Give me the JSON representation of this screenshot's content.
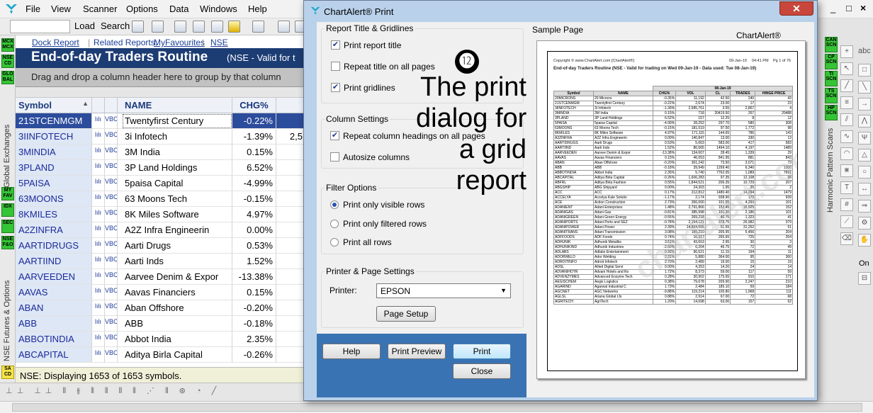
{
  "menu": {
    "items": [
      "File",
      "View",
      "Scanner",
      "Options",
      "Data",
      "Windows",
      "Help"
    ],
    "window_controls": [
      "_",
      "□",
      "×"
    ]
  },
  "toolbar": {
    "load_label": "Load",
    "search_label": "Search"
  },
  "left_strip": {
    "badges": [
      "MCX MCX",
      "NSE CD",
      "GLO BAL",
      "MY FAV",
      "IDX",
      "SEC",
      "NSE F&O",
      "SA CD"
    ],
    "labels": [
      "Global Exchanges",
      "NSE Futures & Options"
    ]
  },
  "report": {
    "dock_report": "Dock Report",
    "related_reports_label": "Related Reports:",
    "my_favourites": "MyFavourites",
    "nse": "NSE",
    "title": "End-of-day Traders Routine",
    "subtitle": "(NSE - Valid for t",
    "group_hint": "Drag and drop a column header here to group by that column"
  },
  "grid": {
    "columns": {
      "symbol": "Symbol",
      "name": "NAME",
      "chg": "CHG%"
    },
    "rows": [
      {
        "symbol": "21STCENMGM",
        "name": "Twentyfirst Century",
        "chg": "-0.22%",
        "vol": "",
        "selected": true
      },
      {
        "symbol": "3IINFOTECH",
        "name": "3i Infotech",
        "chg": "-1.39%",
        "vol": "2,5"
      },
      {
        "symbol": "3MINDIA",
        "name": "3M India",
        "chg": "0.15%",
        "vol": ""
      },
      {
        "symbol": "3PLAND",
        "name": "3P Land Holdings",
        "chg": "6.52%",
        "vol": ""
      },
      {
        "symbol": "5PAISA",
        "name": "5paisa Capital",
        "chg": "-4.99%",
        "vol": ""
      },
      {
        "symbol": "63MOONS",
        "name": "63 Moons Tech",
        "chg": "-0.15%",
        "vol": ""
      },
      {
        "symbol": "8KMILES",
        "name": "8K Miles Software",
        "chg": "4.97%",
        "vol": ""
      },
      {
        "symbol": "A2ZINFRA",
        "name": "A2Z Infra Engineerin",
        "chg": "0.00%",
        "vol": ""
      },
      {
        "symbol": "AARTIDRUGS",
        "name": "Aarti Drugs",
        "chg": "0.53%",
        "vol": ""
      },
      {
        "symbol": "AARTIIND",
        "name": "Aarti Inds",
        "chg": "1.52%",
        "vol": ""
      },
      {
        "symbol": "AARVEEDEN",
        "name": "Aarvee Denim & Expor",
        "chg": "-13.38%",
        "vol": ""
      },
      {
        "symbol": "AAVAS",
        "name": "Aavas Financiers",
        "chg": "0.15%",
        "vol": ""
      },
      {
        "symbol": "ABAN",
        "name": "Aban Offshore",
        "chg": "-0.20%",
        "vol": ""
      },
      {
        "symbol": "ABB",
        "name": "ABB",
        "chg": "-0.18%",
        "vol": ""
      },
      {
        "symbol": "ABBOTINDIA",
        "name": "Abbot India",
        "chg": "2.35%",
        "vol": ""
      },
      {
        "symbol": "ABCAPITAL",
        "name": "Aditya Birla Capital",
        "chg": "-0.26%",
        "vol": ""
      }
    ],
    "icon1": "lılı",
    "icon2": "VBC",
    "status": "NSE: Displaying 1653 of 1653 symbols."
  },
  "right_panel": {
    "badges": [
      "CAN SCN",
      "CP SCN",
      "TI SCN",
      "TS SCN",
      "HP SCN"
    ],
    "vertical_label": "Harmonic Pattern Scans",
    "on_label": "On",
    "tools_top": "abc"
  },
  "dialog": {
    "title": "ChartAlert® Print",
    "close": "✕",
    "report_title_group": "Report Title & Gridlines",
    "print_report_title": "Print report title",
    "repeat_title": "Repeat title on all pages",
    "print_gridlines": "Print gridlines",
    "column_settings_group": "Column Settings",
    "repeat_headings": "Repeat column headings on all pages",
    "autosize_columns": "Autosize columns",
    "filter_group": "Filter Options",
    "print_visible": "Print only visible rows",
    "print_filtered": "Print only filtered rows",
    "print_all": "Print all rows",
    "printer_group": "Printer & Page Settings",
    "printer_label": "Printer:",
    "printer_value": "EPSON",
    "page_setup": "Page Setup",
    "help": "Help",
    "print_preview": "Print Preview",
    "print": "Print",
    "close_btn": "Close",
    "sample_page": "Sample Page",
    "brand": "ChartAlert®",
    "checks": {
      "print_report_title": true,
      "repeat_title": false,
      "print_gridlines": true,
      "repeat_headings": true,
      "autosize_columns": false
    },
    "filter_selected": "visible"
  },
  "preview": {
    "copyright": "Copyright © www.ChartAlert.com [ChartAlert®]",
    "date": "09-Jan-19",
    "time": "04:41 PM",
    "page": "Pg 1 of 76",
    "title": "End-of-day Traders Routine (NSE - Valid for trading on Wed 09-Jan-19 - Data used: Tue 08-Jan-19)",
    "table_date": "08-Jan-19",
    "headers": [
      "Symbol",
      "NAME",
      "CHG%",
      "VOL",
      "CL",
      "TRADES",
      "HINGE PRICE"
    ],
    "watermark": "chartalert.com",
    "rows": [
      [
        "20MICRONS",
        "20 Microns",
        "-0.35%",
        "11,192",
        "42.50",
        "240",
        "43"
      ],
      [
        "21STCENMGM",
        "Twentyfirst Century",
        "-0.22%",
        "2,674",
        "23.00",
        "17",
        "23"
      ],
      [
        "3IINFOTECH",
        "3i Infotech",
        "-1.39%",
        "2,585,761",
        "3.55",
        "2,867",
        "4"
      ],
      [
        "3MINDIA",
        "3M India",
        "0.15%",
        "718",
        "20419.50",
        "267",
        "20488"
      ],
      [
        "3PLAND",
        "3P Land Holdings",
        "6.52%",
        "157",
        "12.25",
        "8",
        "12"
      ],
      [
        "5PAISA",
        "5paisa Capital",
        "-4.99%",
        "28,252",
        "297.70",
        "580",
        "308"
      ],
      [
        "63MOONS",
        "63 Moons Tech",
        "-0.15%",
        "181,519",
        "97.50",
        "1,772",
        "98"
      ],
      [
        "8KMILES",
        "8K Miles Software",
        "4.97%",
        "171,115",
        "144.65",
        "786",
        "143"
      ],
      [
        "A2ZINFRA",
        "A2Z Infra Engineerin",
        "0.00%",
        "140,847",
        "13.00",
        "330",
        "13"
      ],
      [
        "AARTIDRUGS",
        "Aarti Drugs",
        "0.53%",
        "5,663",
        "583.00",
        "417",
        "583"
      ],
      [
        "AARTIIND",
        "Aarti Inds",
        "1.52%",
        "86,665",
        "1494.10",
        "4,197",
        "1489"
      ],
      [
        "AARVEEDEN",
        "Aarvee Denim & Expor",
        "-13.38%",
        "134,607",
        "28.45",
        "1,339",
        "29"
      ],
      [
        "AAVAS",
        "Aavas Financiers",
        "0.15%",
        "46,053",
        "841.95",
        "881",
        "843"
      ],
      [
        "ABAN",
        "Aban Offshore",
        "-0.20%",
        "301,242",
        "73.50",
        "3,071",
        "73"
      ],
      [
        "ABB",
        "ABB",
        "-0.18%",
        "39,949",
        "1299.40",
        "6,340",
        "1300"
      ],
      [
        "ABBOTINDIA",
        "Abbot India",
        "2.35%",
        "5,740",
        "7762.05",
        "1,089",
        "7691"
      ],
      [
        "ABCAPITAL",
        "Aditya Birla Capital",
        "-0.26%",
        "1,606,283",
        "97.35",
        "12,108",
        "98"
      ],
      [
        "ABFRL",
        "Aditya Birla Fashion",
        "0.55%",
        "1,844,521",
        "206.35",
        "10,729",
        "207"
      ],
      [
        "ABGSHIP",
        "ABG Shipyard",
        "0.00%",
        "24,303",
        "1.95",
        "35",
        "2"
      ],
      [
        "ACC",
        "ACC",
        "0.17%",
        "212,812",
        "1480.40",
        "14,294",
        "1479"
      ],
      [
        "ACCELYA",
        "Accelya Kale Solutio",
        "-1.17%",
        "2,174",
        "938.90",
        "170",
        "939"
      ],
      [
        "ACE",
        "Action Construction",
        "2.73%",
        "356,000",
        "101.55",
        "4,293",
        "101"
      ],
      [
        "ADANIENT",
        "Adani Enterprises",
        "1.48%",
        "2,791,866",
        "153.45",
        "16,925",
        "152"
      ],
      [
        "ADANIGAS",
        "Adani Gas",
        "-0.81%",
        "385,998",
        "101.30",
        "2,186",
        "101"
      ],
      [
        "ADANIGREEN",
        "Adani Green Energy",
        "-0.55%",
        "269,218",
        "40.75",
        "1,323",
        "41"
      ],
      [
        "ADANIPORTS",
        "Adani Ports and SEZ",
        "-0.78%",
        "2,154,121",
        "378.75",
        "26,982",
        "379"
      ],
      [
        "ADANIPOWER",
        "Adani Power",
        "2.39%",
        "14,864,555",
        "51.55",
        "31,252",
        "51"
      ],
      [
        "ADANITRANS",
        "Adani Transmission",
        "3.08%",
        "189,210",
        "205.95",
        "5,456",
        "204"
      ],
      [
        "ADFFOODS",
        "ADF Foods",
        "0.74%",
        "16,317",
        "265.65",
        "725",
        "264"
      ],
      [
        "ADHUNIK",
        "Adhunik Metaliks",
        "3.51%",
        "43,653",
        "2.95",
        "30",
        "3"
      ],
      [
        "ADHUNIKIND",
        "Adhunik Industries",
        "-2.60%",
        "6,204",
        "46.75",
        "72",
        "49"
      ],
      [
        "ADLABS",
        "Adlabs Entertainment",
        "0.92%",
        "96,621",
        "11.15",
        "194",
        "11"
      ],
      [
        "ADORWELD",
        "Ador Welding",
        "2.31%",
        "5,880",
        "364.00",
        "95",
        "360"
      ],
      [
        "ADROITINFO",
        "Adroit Infotech",
        "2.70%",
        "2,489",
        "19.00",
        "15",
        "19"
      ],
      [
        "ADSL",
        "Allied Digital Servi",
        "0.00%",
        "4,353",
        "14.20",
        "24",
        "14"
      ],
      [
        "ADVANIHOTR",
        "Advani Hotels and Rs",
        "1.72%",
        "8,373",
        "59.00",
        "117",
        "59"
      ],
      [
        "ADVENZYMES",
        "Advanced Enzyme Tech",
        "0.28%",
        "30,902",
        "175.65",
        "910",
        "171"
      ],
      [
        "AEGISCHEM",
        "Aegis Logistics",
        "0.38%",
        "79,678",
        "209.90",
        "2,247",
        "210"
      ],
      [
        "AGARIND",
        "Agarwal Industrial C",
        "1.73%",
        "2,484",
        "185.10",
        "59",
        "184"
      ],
      [
        "AGCNET",
        "AGC Networks",
        "-9.88%",
        "119,214",
        "105.80",
        "1,968",
        "111"
      ],
      [
        "AGLSL",
        "Ariana Global Lfs",
        "0.88%",
        "2,914",
        "67.00",
        "72",
        "68"
      ],
      [
        "AGRITECH",
        "AgriTech",
        "1.20%",
        "14,698",
        "63.00",
        "157",
        "62"
      ]
    ]
  },
  "annotation": {
    "number": "⓬",
    "lines": [
      "The print",
      "dialog for",
      "a grid",
      "report"
    ]
  }
}
